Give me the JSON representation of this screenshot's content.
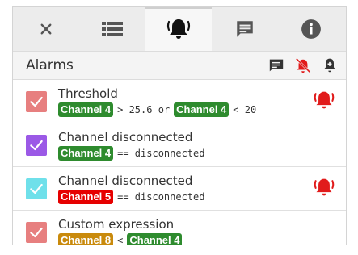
{
  "tabs": [
    {
      "name": "tab-close",
      "icon": "close-icon",
      "active": false
    },
    {
      "name": "tab-list",
      "icon": "list-icon",
      "active": false
    },
    {
      "name": "tab-alarms",
      "icon": "bell-ringing-icon",
      "active": true
    },
    {
      "name": "tab-messages",
      "icon": "message-icon",
      "active": false
    },
    {
      "name": "tab-info",
      "icon": "info-icon",
      "active": false
    }
  ],
  "header": {
    "title": "Alarms",
    "icons": [
      "message-icon",
      "mute-icon",
      "add-alarm-icon"
    ]
  },
  "colors": {
    "green": "#2e8b2e",
    "red": "#e60000",
    "orange": "#c98a0c",
    "bell_red": "#e11b1b",
    "cb_salmon": "#e77f7f",
    "cb_purple": "#9b59e6",
    "cb_cyan": "#6fe0ea"
  },
  "alarms": [
    {
      "name": "Threshold",
      "checkbox_color": "#e77f7f",
      "ringing": true,
      "expression": [
        {
          "type": "chip",
          "text": "Channel 4",
          "color": "#2e8b2e"
        },
        {
          "type": "op",
          "text": "> 25.6 or"
        },
        {
          "type": "chip",
          "text": "Channel 4",
          "color": "#2e8b2e"
        },
        {
          "type": "op",
          "text": "< 20"
        }
      ]
    },
    {
      "name": "Channel disconnected",
      "checkbox_color": "#9b59e6",
      "ringing": false,
      "expression": [
        {
          "type": "chip",
          "text": "Channel 4",
          "color": "#2e8b2e"
        },
        {
          "type": "op",
          "text": "== disconnected"
        }
      ]
    },
    {
      "name": "Channel disconnected",
      "checkbox_color": "#6fe0ea",
      "ringing": true,
      "expression": [
        {
          "type": "chip",
          "text": "Channel 5",
          "color": "#e60000"
        },
        {
          "type": "op",
          "text": "== disconnected"
        }
      ]
    },
    {
      "name": "Custom expression",
      "checkbox_color": "#e77f7f",
      "ringing": false,
      "expression": [
        {
          "type": "chip",
          "text": "Channel 8",
          "color": "#c98a0c"
        },
        {
          "type": "op",
          "text": "<"
        },
        {
          "type": "chip",
          "text": "Channel 4",
          "color": "#2e8b2e"
        }
      ]
    }
  ]
}
